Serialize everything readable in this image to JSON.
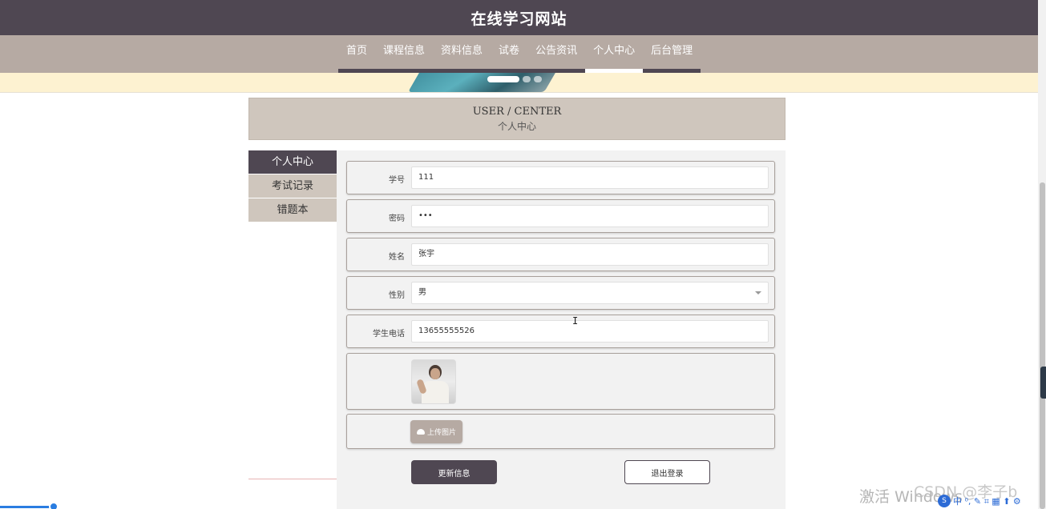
{
  "header": {
    "title": "在线学习网站"
  },
  "nav": {
    "items": [
      {
        "label": "首页",
        "active": false
      },
      {
        "label": "课程信息",
        "active": false
      },
      {
        "label": "资料信息",
        "active": false
      },
      {
        "label": "试卷",
        "active": false
      },
      {
        "label": "公告资讯",
        "active": false
      },
      {
        "label": "个人中心",
        "active": true
      },
      {
        "label": "后台管理",
        "active": false
      }
    ]
  },
  "section": {
    "title_en": "USER / CENTER",
    "title_cn": "个人中心"
  },
  "sidebar": {
    "items": [
      {
        "label": "个人中心",
        "active": true
      },
      {
        "label": "考试记录",
        "active": false
      },
      {
        "label": "错题本",
        "active": false
      }
    ]
  },
  "form": {
    "student_id": {
      "label": "学号",
      "value": "111"
    },
    "password": {
      "label": "密码",
      "value": "•••"
    },
    "name": {
      "label": "姓名",
      "value": "张宇"
    },
    "gender": {
      "label": "性别",
      "value": "男"
    },
    "phone": {
      "label": "学生电话",
      "value": "13655555526"
    },
    "upload_label": "上传图片",
    "update_button": "更新信息",
    "logout_button": "退出登录"
  },
  "overlay": {
    "watermark": "激活 Windows",
    "csdn": "CSDN @李子b",
    "ime_text": "中 ⁰, ✎ ⌗ ▦ ⬆ ⚙"
  },
  "colors": {
    "dark": "#4f4752",
    "nav_bg": "#b6aaa3",
    "beige": "#cfc6bd",
    "banner": "#fdf2d1"
  }
}
